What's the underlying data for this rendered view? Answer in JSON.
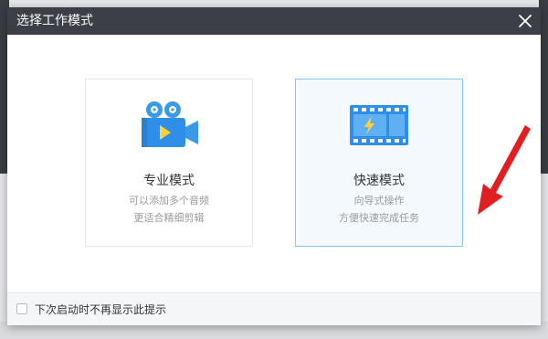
{
  "dialog": {
    "title": "选择工作模式",
    "close_icon": "close-icon"
  },
  "modes": {
    "pro": {
      "title": "专业模式",
      "desc_line1": "可以添加多个音频",
      "desc_line2": "更适合精细剪辑",
      "icon": "video-camera-icon"
    },
    "quick": {
      "title": "快速模式",
      "desc_line1": "向导式操作",
      "desc_line2": "方便快速完成任务",
      "icon": "film-strip-icon"
    }
  },
  "footer": {
    "checkbox_label": "下次启动时不再显示此提示",
    "checked": false
  },
  "colors": {
    "titlebar": "#3c3f46",
    "accent_blue": "#2f8ee8",
    "highlight_border": "#8cc4ec",
    "arrow_red": "#e02020"
  }
}
